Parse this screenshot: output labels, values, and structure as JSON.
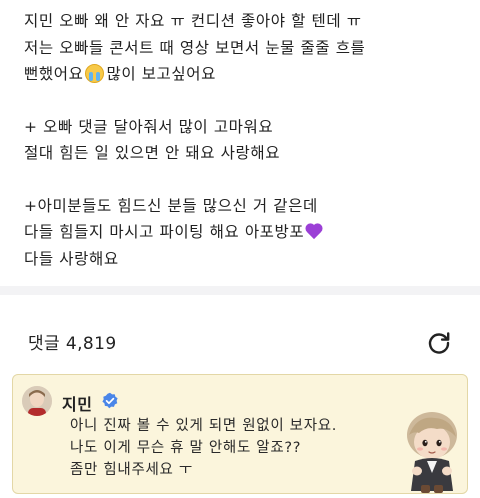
{
  "post": {
    "paragraphs": [
      {
        "lines": [
          "지민 오빠 왜 안 자요 ㅠ 컨디션 좋아야 할 텐데 ㅠ",
          "저는 오빠들 콘서트 때 영상 보면서 눈물 줄줄 흐를",
          "뻔했어요"
        ],
        "line3_suffix": "많이 보고싶어요",
        "line3_emoji": "crying-face-emoji"
      },
      {
        "lines": [
          "+ 오빠 댓글 달아줘서 많이 고마워요",
          "절대 힘든 일 있으면 안 돼요 사랑해요"
        ]
      },
      {
        "lines": [
          "+아미분들도 힘드신 분들 많으신 거 같은데",
          "다들 힘들지 마시고 파이팅 해요 아포방포",
          "다들 사랑해요"
        ],
        "heart_emoji": "purple-heart-emoji"
      }
    ]
  },
  "comments": {
    "count_label": "댓글 4,819",
    "refresh_icon": "refresh-icon"
  },
  "artist_comment": {
    "author": "지민",
    "verified_icon": "verified-badge-icon",
    "lines": [
      "아니 진짜 볼 수 있게 되면 원없이 보자요.",
      "나도 이게 무슨 휴 말 안해도 알죠??",
      "좀만 힘내주세요 ㅜ"
    ],
    "sticker": "character-sticker",
    "bg_color": "#fbf5dc",
    "badge_color": "#4a86e8"
  }
}
